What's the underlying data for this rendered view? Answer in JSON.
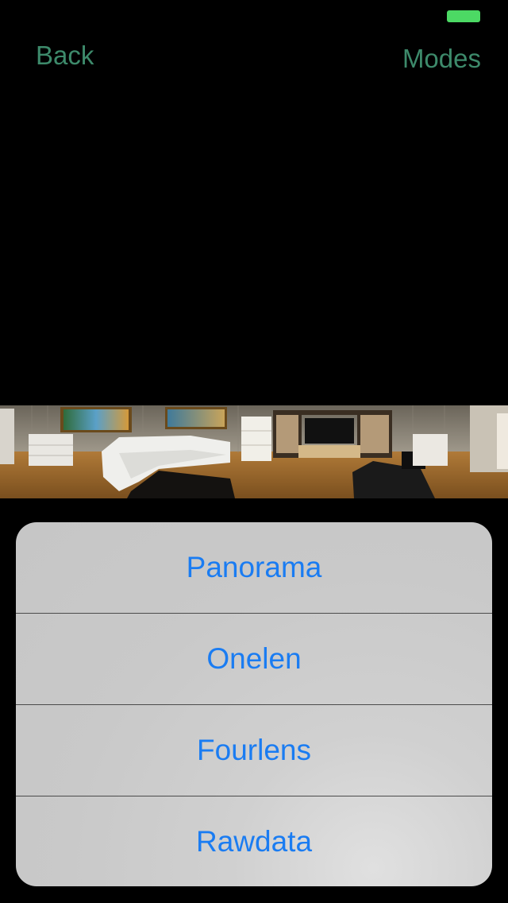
{
  "status_bar": {
    "battery_color": "#4cd964"
  },
  "nav": {
    "back_label": "Back",
    "modes_label": "Modes",
    "tint": "#3d8a6b"
  },
  "panorama": {
    "description_icon": "panorama-image"
  },
  "action_sheet": {
    "tint": "#1a7cf2",
    "items": [
      {
        "label": "Panorama"
      },
      {
        "label": "Onelen"
      },
      {
        "label": "Fourlens"
      },
      {
        "label": "Rawdata"
      }
    ]
  }
}
